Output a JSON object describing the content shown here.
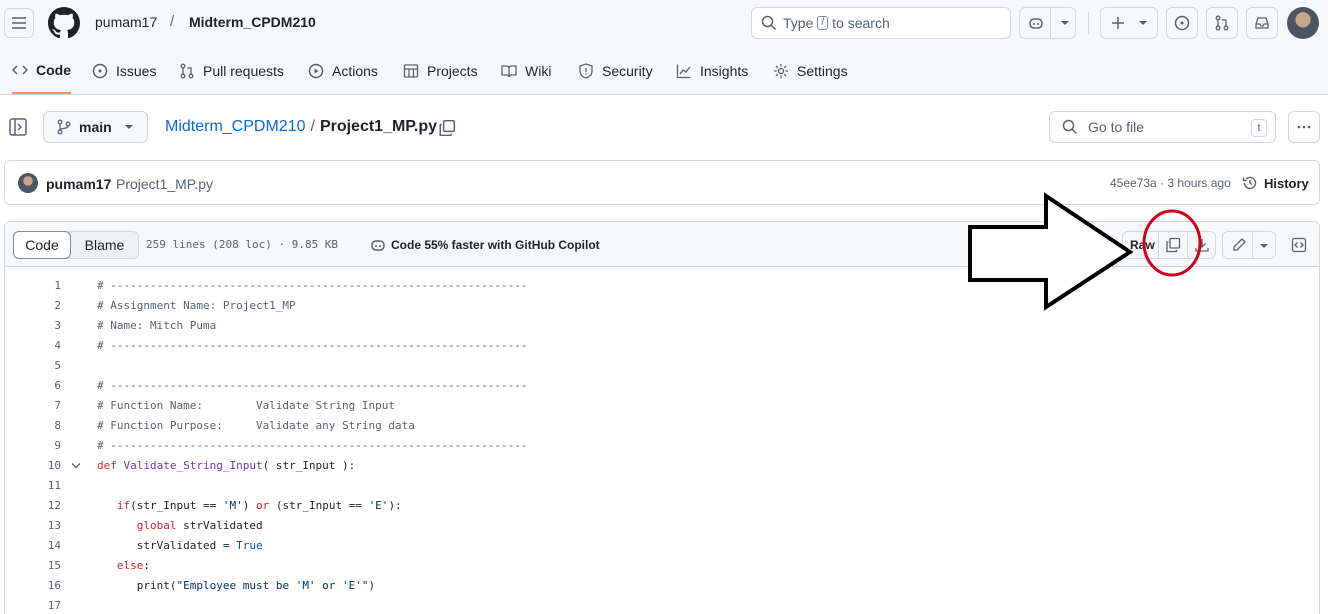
{
  "header": {
    "owner": "pumam17",
    "separator": "/",
    "repo": "Midterm_CPDM210",
    "search_pre": "Type",
    "search_key": "/",
    "search_post": "to search"
  },
  "nav": {
    "items": [
      {
        "label": "Code",
        "icon": "code-icon",
        "active": true
      },
      {
        "label": "Issues",
        "icon": "issue-icon"
      },
      {
        "label": "Pull requests",
        "icon": "pull-request-icon"
      },
      {
        "label": "Actions",
        "icon": "play-icon"
      },
      {
        "label": "Projects",
        "icon": "table-icon"
      },
      {
        "label": "Wiki",
        "icon": "book-icon"
      },
      {
        "label": "Security",
        "icon": "shield-icon"
      },
      {
        "label": "Insights",
        "icon": "graph-icon"
      },
      {
        "label": "Settings",
        "icon": "gear-icon"
      }
    ]
  },
  "file_nav": {
    "branch": "main",
    "path_repo": "Midterm_CPDM210",
    "path_sep": "/",
    "path_file": "Project1_MP.py",
    "goto_placeholder": "Go to file",
    "goto_key": "t"
  },
  "commit": {
    "author": "pumam17",
    "message": "Project1_MP.py",
    "meta": "45ee73a · 3 hours ago",
    "history_label": "History"
  },
  "file_header": {
    "tab_code": "Code",
    "tab_blame": "Blame",
    "info": "259 lines (208 loc) · 9.85 KB",
    "copilot_promo": "Code 55% faster with GitHub Copilot",
    "raw_label": "Raw"
  },
  "code": {
    "lines": [
      {
        "n": "1",
        "tokens": [
          {
            "t": "# ---------------------------------------------------------------",
            "c": "cm"
          }
        ]
      },
      {
        "n": "2",
        "tokens": [
          {
            "t": "# Assignment Name: Project1_MP",
            "c": "cm"
          }
        ]
      },
      {
        "n": "3",
        "tokens": [
          {
            "t": "# Name: Mitch Puma",
            "c": "cm"
          }
        ]
      },
      {
        "n": "4",
        "tokens": [
          {
            "t": "# ---------------------------------------------------------------",
            "c": "cm"
          }
        ]
      },
      {
        "n": "5",
        "tokens": []
      },
      {
        "n": "6",
        "tokens": [
          {
            "t": "# ---------------------------------------------------------------",
            "c": "cm"
          }
        ]
      },
      {
        "n": "7",
        "tokens": [
          {
            "t": "# Function Name:        Validate String Input",
            "c": "cm"
          }
        ]
      },
      {
        "n": "8",
        "tokens": [
          {
            "t": "# Function Purpose:     Validate any String data",
            "c": "cm"
          }
        ]
      },
      {
        "n": "9",
        "tokens": [
          {
            "t": "# ---------------------------------------------------------------",
            "c": "cm"
          }
        ]
      },
      {
        "n": "10",
        "fold": true,
        "tokens": [
          {
            "t": "def ",
            "c": "kw"
          },
          {
            "t": "Validate_String_Input",
            "c": "fn"
          },
          {
            "t": "( str_Input ):",
            "c": ""
          }
        ]
      },
      {
        "n": "11",
        "tokens": []
      },
      {
        "n": "12",
        "tokens": [
          {
            "t": "   ",
            "c": ""
          },
          {
            "t": "if",
            "c": "kw"
          },
          {
            "t": "(str_Input == ",
            "c": ""
          },
          {
            "t": "'M'",
            "c": "st"
          },
          {
            "t": ") ",
            "c": ""
          },
          {
            "t": "or",
            "c": "kw"
          },
          {
            "t": " (str_Input == ",
            "c": ""
          },
          {
            "t": "'E'",
            "c": "st"
          },
          {
            "t": "):",
            "c": ""
          }
        ]
      },
      {
        "n": "13",
        "tokens": [
          {
            "t": "      ",
            "c": ""
          },
          {
            "t": "global",
            "c": "kw"
          },
          {
            "t": " strValidated",
            "c": ""
          }
        ]
      },
      {
        "n": "14",
        "tokens": [
          {
            "t": "      strValidated = ",
            "c": ""
          },
          {
            "t": "True",
            "c": "bl"
          }
        ]
      },
      {
        "n": "15",
        "tokens": [
          {
            "t": "   ",
            "c": ""
          },
          {
            "t": "else",
            "c": "kw"
          },
          {
            "t": ":",
            "c": ""
          }
        ]
      },
      {
        "n": "16",
        "tokens": [
          {
            "t": "      print(",
            "c": ""
          },
          {
            "t": "\"Employee must be 'M' or 'E'\"",
            "c": "st"
          },
          {
            "t": ")",
            "c": ""
          }
        ]
      },
      {
        "n": "17",
        "tokens": []
      }
    ]
  }
}
